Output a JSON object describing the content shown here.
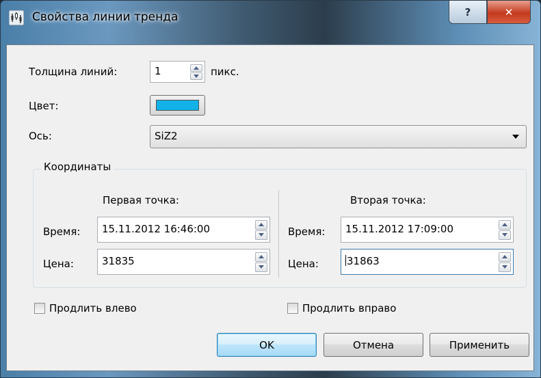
{
  "window": {
    "title": "Свойства линии тренда"
  },
  "line_width": {
    "label": "Толщина линий:",
    "value": "1",
    "unit": "пикс."
  },
  "color": {
    "label": "Цвет:",
    "swatch": "#12b1e8"
  },
  "axis": {
    "label": "Ось:",
    "value": "SiZ2"
  },
  "coordinates": {
    "title": "Координаты",
    "first": {
      "header": "Первая точка:",
      "time_label": "Время:",
      "time_value": "15.11.2012 16:46:00",
      "price_label": "Цена:",
      "price_value": "31835"
    },
    "second": {
      "header": "Вторая точка:",
      "time_label": "Время:",
      "time_value": "15.11.2012 17:09:00",
      "price_label": "Цена:",
      "price_value": "31863"
    }
  },
  "extend_left": {
    "label": "Продлить влево",
    "checked": false
  },
  "extend_right": {
    "label": "Продлить вправо",
    "checked": false
  },
  "buttons": {
    "ok": "OK",
    "cancel": "Отмена",
    "apply": "Применить"
  }
}
